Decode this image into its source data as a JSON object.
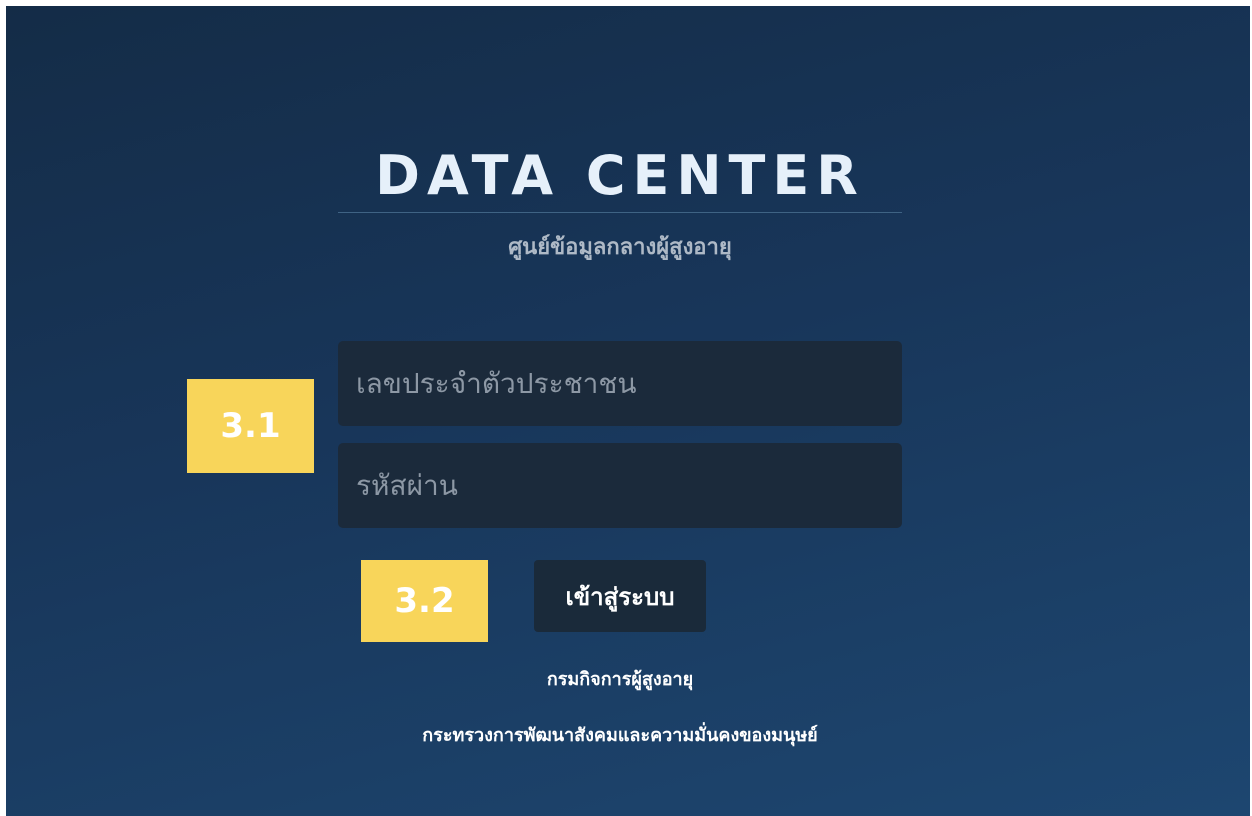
{
  "header": {
    "title": "DATA CENTER",
    "subtitle": "ศูนย์ข้อมูลกลางผู้สูงอายุ"
  },
  "form": {
    "id_placeholder": "เลขประจำตัวประชาชน",
    "password_placeholder": "รหัสผ่าน",
    "login_label": "เข้าสู่ระบบ"
  },
  "annotations": {
    "step_1": "3.1",
    "step_2": "3.2"
  },
  "footer": {
    "department": "กรมกิจการผู้สูงอายุ",
    "ministry": "กระทรวงการพัฒนาสังคมและความมั่นคงของมนุษย์"
  },
  "colors": {
    "background": "#18365a",
    "field": "#1b2a3b",
    "button": "#1a2a3a",
    "badge": "#f8d55a"
  }
}
